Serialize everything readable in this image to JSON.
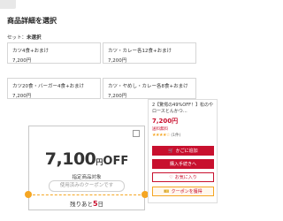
{
  "header": {
    "title": "商品詳細を選択",
    "set_prefix": "セット：",
    "set_value": "未選択"
  },
  "options": [
    {
      "name": "カツ4食+おまけ",
      "price": "7,200円"
    },
    {
      "name": "カツ・カレー各12食+おまけ",
      "price": "7,200円"
    },
    {
      "name": "カツ20食・バーガー4食+おまけ",
      "price": "7,200円"
    },
    {
      "name": "カツ・ヤめし・カレー各8食+おまけ",
      "price": "7,200円"
    }
  ],
  "coupon": {
    "amount": "7,100",
    "yen": "円",
    "off": "OFF",
    "subtitle": "指定商品対象",
    "used_label": "使用済みのクーポンです",
    "remain_prefix": "残りあと",
    "remain_days": "5",
    "remain_suffix": "日"
  },
  "product_panel": {
    "name": "2【驚愕の49%OFF！】松のや ロースとんかつ…",
    "price": "7,200円",
    "shipping": "送料無料",
    "rating_count": "(1件)",
    "stars": "★★★★☆",
    "buttons": {
      "cart": "かごに追加",
      "buy": "購入手続きへ",
      "favorite": "お気に入り",
      "coupon": "クーポンを獲得"
    }
  }
}
